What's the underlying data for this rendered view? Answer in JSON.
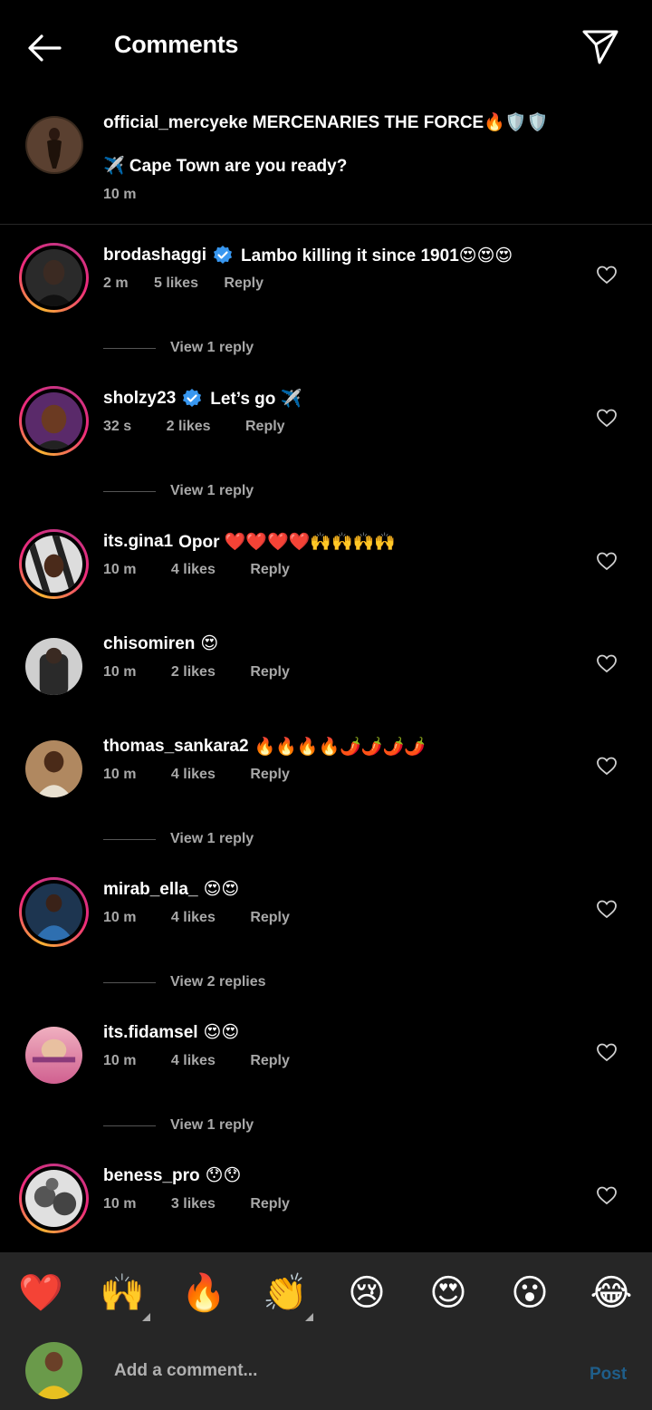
{
  "header": {
    "title": "Comments"
  },
  "caption": {
    "text_line1": "official_mercyeke MERCENARIES THE FORCE🔥🛡️🛡️",
    "text_line2": "✈️ Cape Town are you ready?",
    "time": "10 m"
  },
  "comments": [
    {
      "username": "brodashaggi",
      "verified": true,
      "text": "Lambo killing it since 1901😍😍😍",
      "time": "2 m",
      "likes": "5 likes",
      "reply": "Reply",
      "view_replies": "View 1 reply"
    },
    {
      "username": "sholzy23",
      "verified": true,
      "text": "Let’s go ✈️",
      "time": "32 s",
      "likes": "2 likes",
      "reply": "Reply",
      "view_replies": "View 1 reply"
    },
    {
      "username": "its.gina1",
      "verified": false,
      "text": "Opor ❤️❤️❤️❤️🙌🙌🙌🙌",
      "time": "10 m",
      "likes": "4 likes",
      "reply": "Reply"
    },
    {
      "username": "chisomiren",
      "verified": false,
      "text": "😍",
      "time": "10 m",
      "likes": "2 likes",
      "reply": "Reply"
    },
    {
      "username": "thomas_sankara2",
      "verified": false,
      "text": "🔥🔥🔥🔥🌶️🌶️🌶️🌶️",
      "time": "10 m",
      "likes": "4 likes",
      "reply": "Reply",
      "view_replies": "View 1 reply"
    },
    {
      "username": "mirab_ella_",
      "verified": false,
      "text": "😍😍",
      "time": "10 m",
      "likes": "4 likes",
      "reply": "Reply",
      "view_replies": "View 2 replies"
    },
    {
      "username": "its.fidamsel",
      "verified": false,
      "text": "😍😍",
      "time": "10 m",
      "likes": "4 likes",
      "reply": "Reply",
      "view_replies": "View 1 reply"
    },
    {
      "username": "beness_pro",
      "verified": false,
      "text": "😯😯",
      "time": "10 m",
      "likes": "3 likes",
      "reply": "Reply"
    }
  ],
  "quick_emojis": [
    "❤️",
    "🙌",
    "🔥",
    "👏",
    "😢",
    "😍",
    "😮",
    "😂"
  ],
  "composer": {
    "placeholder": "Add a comment...",
    "post_label": "Post"
  },
  "colors": {
    "background": "#000000",
    "bar": "#262626",
    "secondary_text": "#a8a8a8",
    "verified": "#3897f0",
    "post": "#1f5e8a"
  }
}
